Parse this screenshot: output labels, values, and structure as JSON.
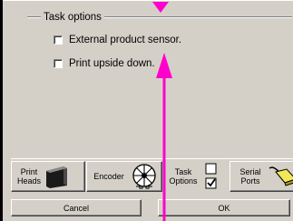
{
  "group": {
    "title": "Task options"
  },
  "options": [
    {
      "label": "External product sensor.",
      "checked": false
    },
    {
      "label": "Print upside down.",
      "checked": false
    }
  ],
  "tabs": [
    {
      "label_line1": "Print",
      "label_line2": "Heads",
      "icon": "print-head-icon"
    },
    {
      "label_line1": "Encoder",
      "label_line2": "",
      "icon": "encoder-wheel-icon"
    },
    {
      "label_line1": "Task",
      "label_line2": "Options",
      "icon": "checkbox-pair-icon",
      "active": true
    },
    {
      "label_line1": "Serial",
      "label_line2": "Ports",
      "icon": "serial-cable-icon"
    }
  ],
  "buttons": {
    "cancel": "Cancel",
    "ok": "OK"
  },
  "annotation": {
    "arrow_color": "#ff00cc"
  }
}
